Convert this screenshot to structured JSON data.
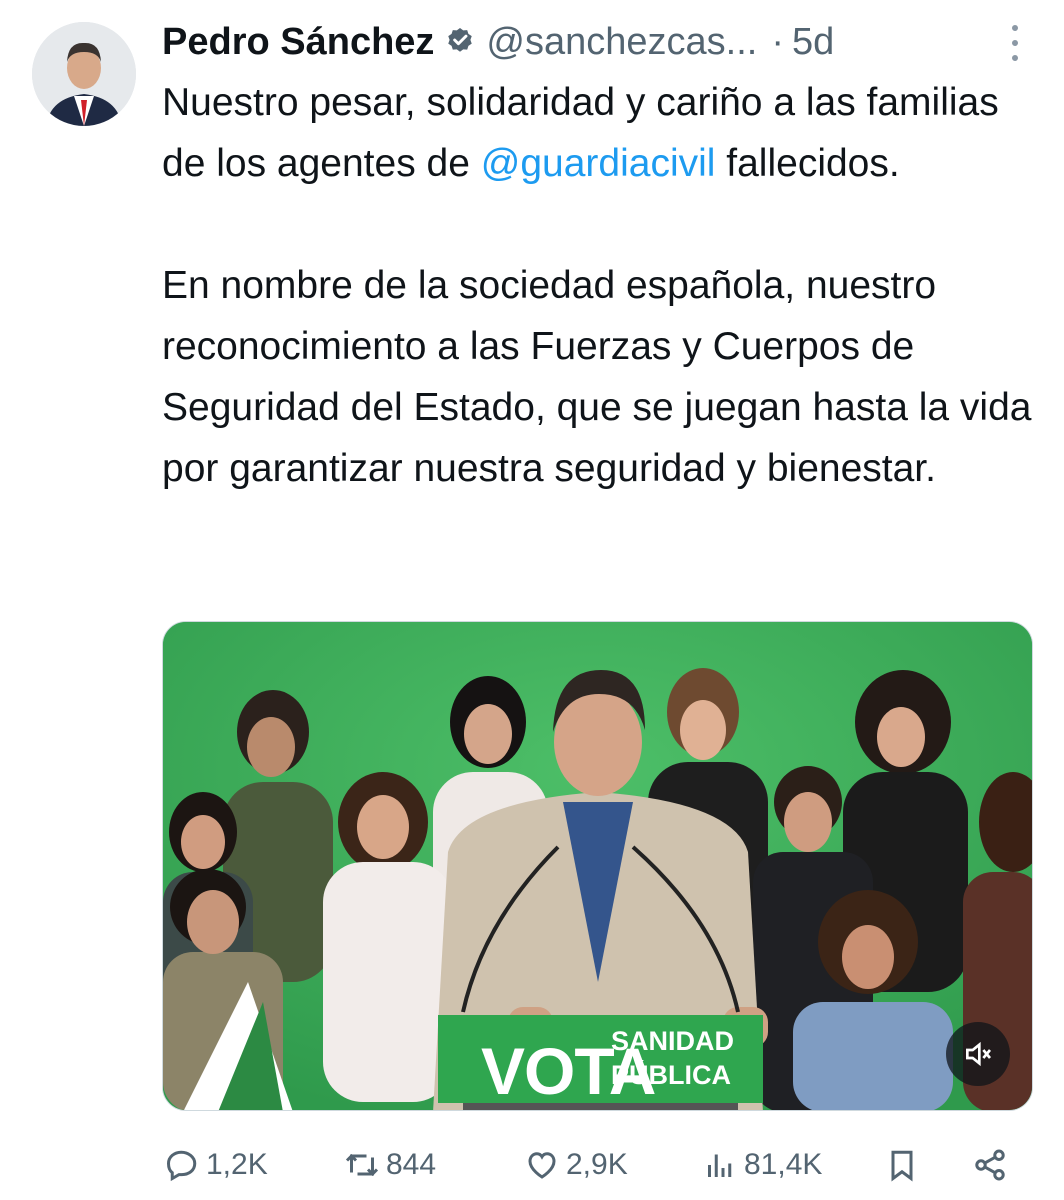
{
  "tweet": {
    "author_name": "Pedro Sánchez",
    "handle": "@sanchezcas...",
    "separator": "·",
    "time": "5d",
    "text_line1_a": "Nuestro pesar, solidaridad y cariño a las familias de los agentes de ",
    "mention": "@guardiacivil",
    "text_line1_b": " fallecidos.",
    "text_para2": "En nombre de la sociedad española, nuestro reconocimiento a las Fuerzas y Cuerpos de Seguridad del Estado, que se juegan hasta la vida por garantizar nuestra seguridad y bienestar."
  },
  "media": {
    "sign_word_1": "VOTA",
    "sign_word_2": "SANIDAD",
    "sign_word_3": "PÚBLICA"
  },
  "actions": {
    "replies": "1,2K",
    "reposts": "844",
    "likes": "2,9K",
    "views": "81,4K"
  },
  "colors": {
    "accent": "#1d9bf0",
    "secondary_text": "#536471",
    "backdrop_green": "#3fae5c"
  },
  "icons": [
    "verified-badge-icon",
    "more-options-icon",
    "mute-icon",
    "reply-icon",
    "repost-icon",
    "like-icon",
    "views-icon",
    "bookmark-icon",
    "share-icon"
  ]
}
